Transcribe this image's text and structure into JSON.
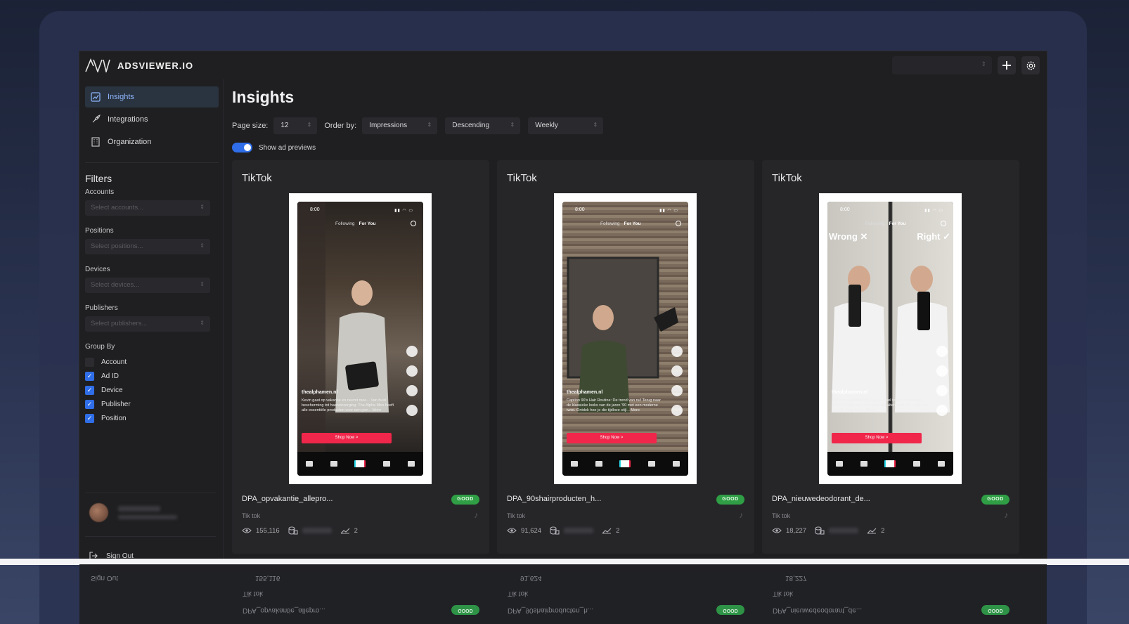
{
  "app": {
    "brand": "ADSVIEWER.IO",
    "org_select_placeholder": ""
  },
  "sidebar": {
    "items": [
      {
        "label": "Insights",
        "icon": "chart-icon",
        "active": true
      },
      {
        "label": "Integrations",
        "icon": "rocket-icon",
        "active": false
      },
      {
        "label": "Organization",
        "icon": "building-icon",
        "active": false
      }
    ],
    "filters_title": "Filters",
    "filters": [
      {
        "label": "Accounts",
        "placeholder": "Select accounts..."
      },
      {
        "label": "Positions",
        "placeholder": "Select positions..."
      },
      {
        "label": "Devices",
        "placeholder": "Select devices..."
      },
      {
        "label": "Publishers",
        "placeholder": "Select publishers..."
      }
    ],
    "group_by_title": "Group By",
    "group_by": [
      {
        "label": "Account",
        "checked": false
      },
      {
        "label": "Ad ID",
        "checked": true
      },
      {
        "label": "Device",
        "checked": true
      },
      {
        "label": "Publisher",
        "checked": true
      },
      {
        "label": "Position",
        "checked": true
      }
    ],
    "sign_out": "Sign Out"
  },
  "main": {
    "title": "Insights",
    "page_size_label": "Page size:",
    "page_size": "12",
    "order_by_label": "Order by:",
    "order_by": "Impressions",
    "direction": "Descending",
    "period": "Weekly",
    "toggle_label": "Show ad previews",
    "toggle_on": true
  },
  "cards": [
    {
      "platform": "TikTok",
      "ad_name": "DPA_opvakantie_allepro...",
      "badge": "GOOD",
      "sub": "Tik tok",
      "impressions": "155,116",
      "count": "2",
      "preview": {
        "time": "8:00",
        "tab_following": "Following",
        "tab_foryou": "For You",
        "handle": "thealphamen.nl",
        "caption": "Kevin gaat op vakantie en neemt mee... Van huid bescherming tot haarverzorging. The Alpha Men heeft alle essentiële producten voor een goe... More",
        "shop": "Shop Now >",
        "overlay_left": "",
        "overlay_right": ""
      }
    },
    {
      "platform": "TikTok",
      "ad_name": "DPA_90shairproducten_h...",
      "badge": "GOOD",
      "sub": "Tik tok",
      "impressions": "91,624",
      "count": "2",
      "preview": {
        "time": "8:00",
        "tab_following": "Following",
        "tab_foryou": "For You",
        "handle": "thealphamen.nl",
        "caption": "Caption 90's Hair Routine: De trend van nu! Terug naar de klassieke looks van de jaren '90 met een moderne twist. Ontdek hoe je die tijdloze stijl... More",
        "shop": "Shop Now >",
        "overlay_left": "",
        "overlay_right": ""
      }
    },
    {
      "platform": "TikTok",
      "ad_name": "DPA_nieuwedeodorant_de...",
      "badge": "GOOD",
      "sub": "Tik tok",
      "impressions": "18,227",
      "count": "2",
      "preview": {
        "time": "8:00",
        "tab_following": "Following",
        "tab_foryou": "For You",
        "handle": "thealphamen.nl",
        "caption": "Tijd voor verandering! Zeg vaarwel tegen schadelijke deo's en kies voor een gezonde alternatief die werkt voor je huid. Stap over... More",
        "shop": "Shop Now >",
        "overlay_left": "Wrong ✕",
        "overlay_right": "Right ✓"
      }
    }
  ],
  "colors": {
    "accent": "#2f6ee8",
    "good": "#2f9e45",
    "panel": "#1f1f21",
    "card": "#262629"
  }
}
